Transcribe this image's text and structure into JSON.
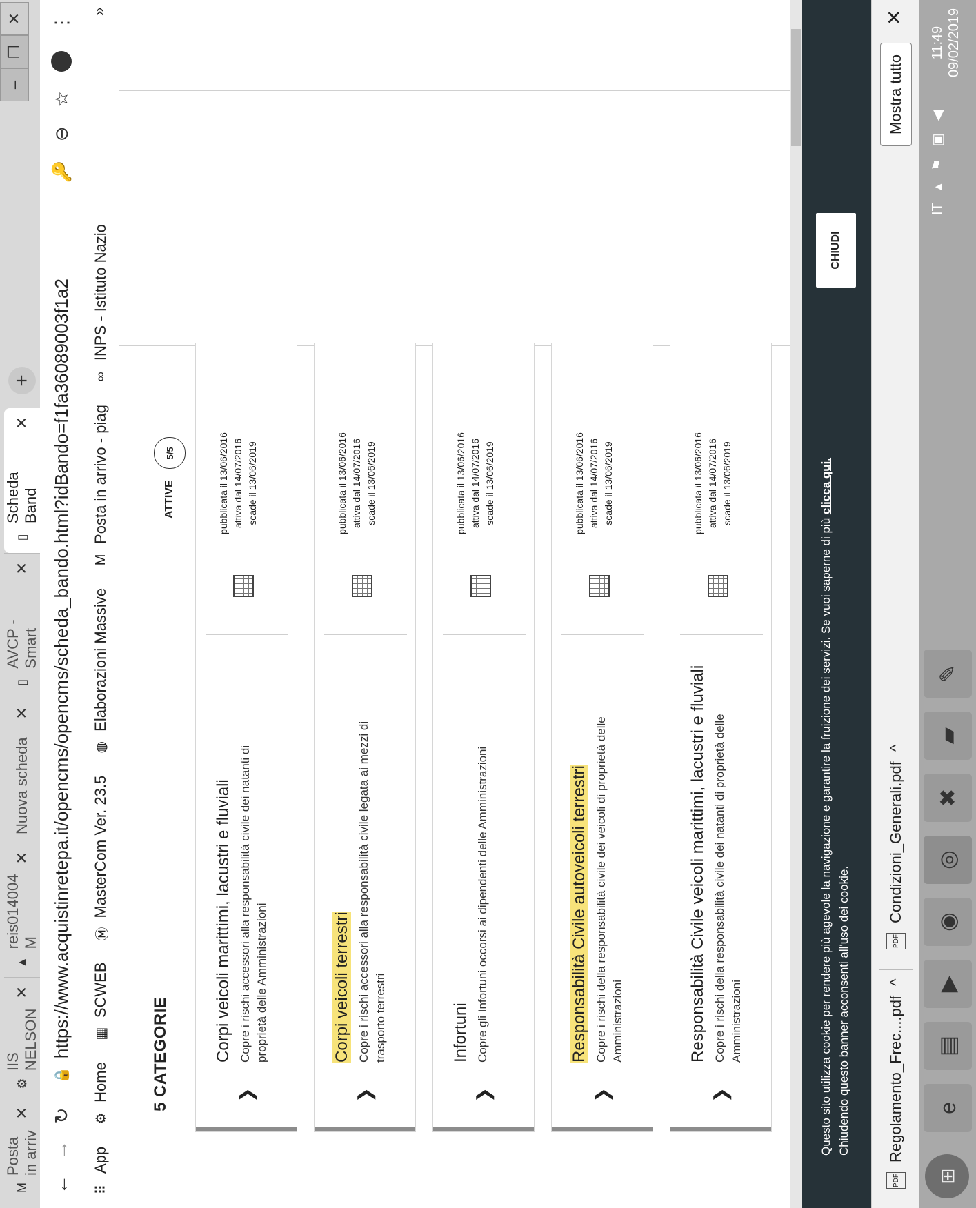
{
  "tabs": [
    {
      "label": "Posta in arriv",
      "icon": "gmail-icon"
    },
    {
      "label": "IIS NELSON",
      "icon": "school-icon"
    },
    {
      "label": "reis014004 M",
      "icon": "drive-icon"
    },
    {
      "label": "Nuova scheda",
      "icon": ""
    },
    {
      "label": "AVCP - Smart",
      "icon": "page-icon"
    },
    {
      "label": "Scheda Band",
      "icon": "page-icon"
    }
  ],
  "address": {
    "url": "https://www.acquistinretepa.it/opencms/opencms/scheda_bando.html?idBando=f1fa36089003f1a2"
  },
  "bookmarks": [
    {
      "label": "App",
      "icon": "apps-grid-icon"
    },
    {
      "label": "Home",
      "icon": "school-icon"
    },
    {
      "label": "SCWEB",
      "icon": "scweb-icon"
    },
    {
      "label": "MasterCom Ver. 23.5",
      "icon": "mastercom-icon"
    },
    {
      "label": "Elaborazioni Massive",
      "icon": "globe-icon"
    },
    {
      "label": "Posta in arrivo - piag",
      "icon": "gmail-icon"
    },
    {
      "label": "INPS - Istituto Nazio",
      "icon": "inps-icon"
    }
  ],
  "page": {
    "title": "5 CATEGORIE",
    "attive_label": "ATTIVE",
    "attive_count": "5/5",
    "categories": [
      {
        "title": "Corpi veicoli marittimi, lacustri e fluviali",
        "desc": "Copre i rischi accessori alla responsabilità civile dei natanti di proprietà delle Amministrazioni",
        "pub": "pubblicata il 13/06/2016",
        "act": "attiva dal 14/07/2016",
        "exp": "scade il 13/06/2019"
      },
      {
        "title": "Corpi veicoli terrestri",
        "desc": "Copre i rischi accessori alla responsabilità civile legata ai mezzi di trasporto terrestri",
        "pub": "pubblicata il 13/06/2016",
        "act": "attiva dal 14/07/2016",
        "exp": "scade il 13/06/2019"
      },
      {
        "title": "Infortuni",
        "desc": "Copre gli Infortuni occorsi ai dipendenti delle Amministrazioni",
        "pub": "pubblicata il 13/06/2016",
        "act": "attiva dal 14/07/2016",
        "exp": "scade il 13/06/2019"
      },
      {
        "title": "Responsabilità Civile autoveicoli terrestri",
        "desc": "Copre i rischi della responsabilità civile dei veicoli di proprietà delle Amministrazioni",
        "pub": "pubblicata il 13/06/2016",
        "act": "attiva dal 14/07/2016",
        "exp": "scade il 13/06/2019"
      },
      {
        "title": "Responsabilità Civile veicoli marittimi, lacustri e fluviali",
        "desc": "Copre i rischi della responsabilità civile dei natanti di proprietà delle Amministrazioni",
        "pub": "pubblicata il 13/06/2016",
        "act": "attiva dal 14/07/2016",
        "exp": "scade il 13/06/2019"
      }
    ]
  },
  "cookie": {
    "text": "Questo sito utilizza cookie per rendere più agevole la navigazione e garantire la fruizione dei servizi. Se vuoi saperne di più",
    "link": "clicca qui.",
    "text2": "Chiudendo questo banner acconsenti all'uso dei cookie.",
    "button": "CHIUDI"
  },
  "downloads": {
    "items": [
      "Regolamento_Frec....pdf",
      "Condizioni_Generali.pdf"
    ],
    "show_all": "Mostra tutto"
  },
  "taskbar": {
    "lang": "IT",
    "time": "11:49",
    "date": "09/02/2019"
  }
}
